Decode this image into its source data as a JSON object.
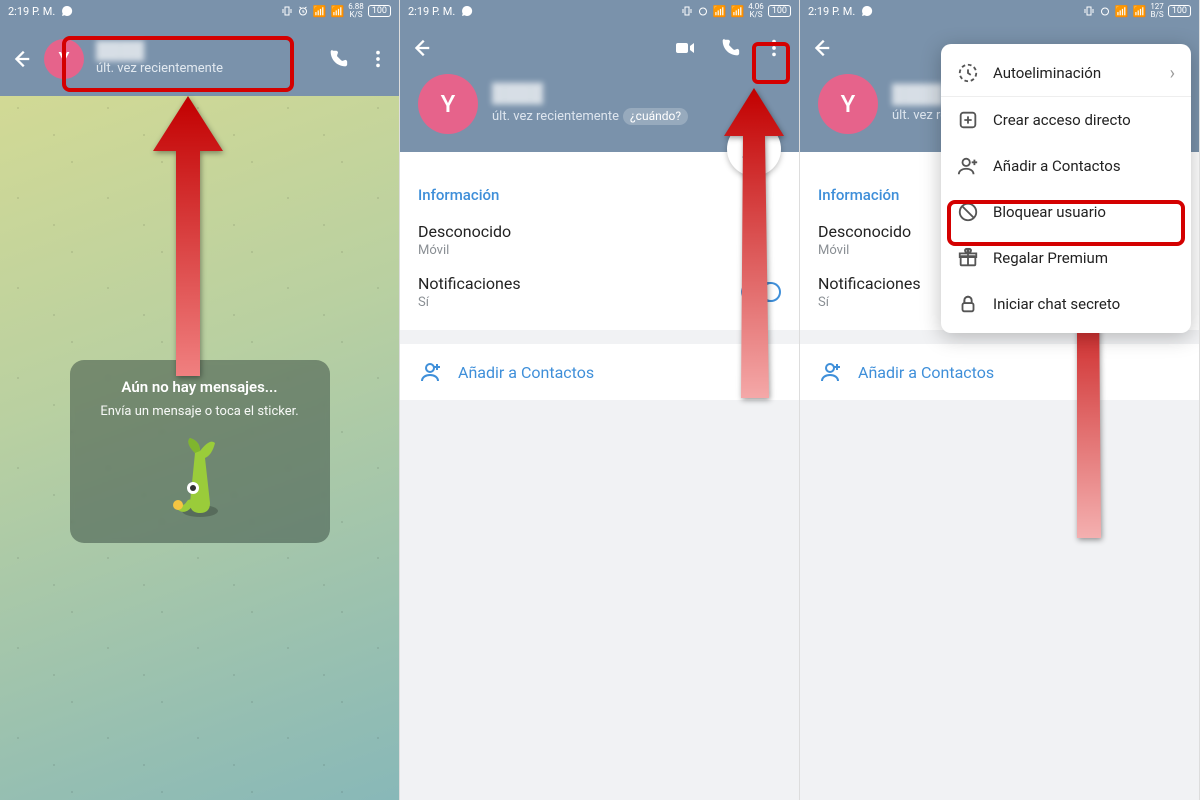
{
  "status": {
    "time": "2:19 P. M.",
    "battery": "100",
    "speed1": "6.88",
    "speed2": "4.06",
    "speed3": "127",
    "ks": "K/S",
    "bs": "B/S"
  },
  "pane1": {
    "avatar_letter": "Y",
    "last_seen": "últ. vez recientemente",
    "empty_title": "Aún no hay mensajes...",
    "empty_body": "Envía un mensaje o toca el sticker."
  },
  "profile": {
    "avatar_letter": "Y",
    "last_seen": "últ. vez recientemente",
    "cuando": "¿cuándo?",
    "section_info": "Información",
    "unknown": "Desconocido",
    "mobile": "Móvil",
    "notifications": "Notificaciones",
    "notif_val": "Sí",
    "add_contacts": "Añadir a Contactos"
  },
  "menu": {
    "autodelete": "Autoeliminación",
    "shortcut": "Crear acceso directo",
    "add_contacts": "Añadir a Contactos",
    "block": "Bloquear usuario",
    "gift": "Regalar Premium",
    "secret": "Iniciar chat secreto"
  }
}
